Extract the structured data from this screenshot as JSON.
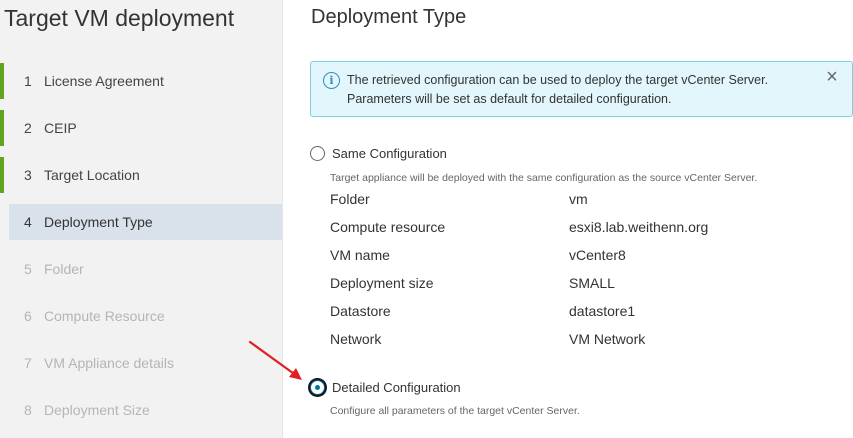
{
  "wizard": {
    "title": "Target VM deployment",
    "steps": [
      {
        "num": "1",
        "label": "License Agreement",
        "state": "done"
      },
      {
        "num": "2",
        "label": "CEIP",
        "state": "done"
      },
      {
        "num": "3",
        "label": "Target Location",
        "state": "done"
      },
      {
        "num": "4",
        "label": "Deployment Type",
        "state": "active"
      },
      {
        "num": "5",
        "label": "Folder",
        "state": "pending"
      },
      {
        "num": "6",
        "label": "Compute Resource",
        "state": "pending"
      },
      {
        "num": "7",
        "label": "VM Appliance details",
        "state": "pending"
      },
      {
        "num": "8",
        "label": "Deployment Size",
        "state": "pending"
      }
    ]
  },
  "page": {
    "title": "Deployment Type"
  },
  "alert": {
    "icon": "info-icon",
    "text": "The retrieved configuration can be used to deploy the target vCenter Server. Parameters will be set as default for detailed configuration.",
    "close_icon": "close-icon"
  },
  "options": {
    "same": {
      "label": "Same Configuration",
      "description": "Target appliance will be deployed with the same configuration as the source vCenter Server.",
      "selected": false,
      "config": [
        {
          "label": "Folder",
          "value": "vm"
        },
        {
          "label": "Compute resource",
          "value": "esxi8.lab.weithenn.org"
        },
        {
          "label": "VM name",
          "value": "vCenter8"
        },
        {
          "label": "Deployment size",
          "value": "SMALL"
        },
        {
          "label": "Datastore",
          "value": "datastore1"
        },
        {
          "label": "Network",
          "value": "VM Network"
        }
      ]
    },
    "detailed": {
      "label": "Detailed Configuration",
      "description": "Configure all parameters of the target vCenter Server.",
      "selected": true
    }
  },
  "colors": {
    "done_bar": "#62a420",
    "active_bg": "#d9e2ea",
    "alert_bg": "#e2f6fb",
    "alert_border": "#7ccfe4",
    "annotation_arrow": "#e02020"
  }
}
